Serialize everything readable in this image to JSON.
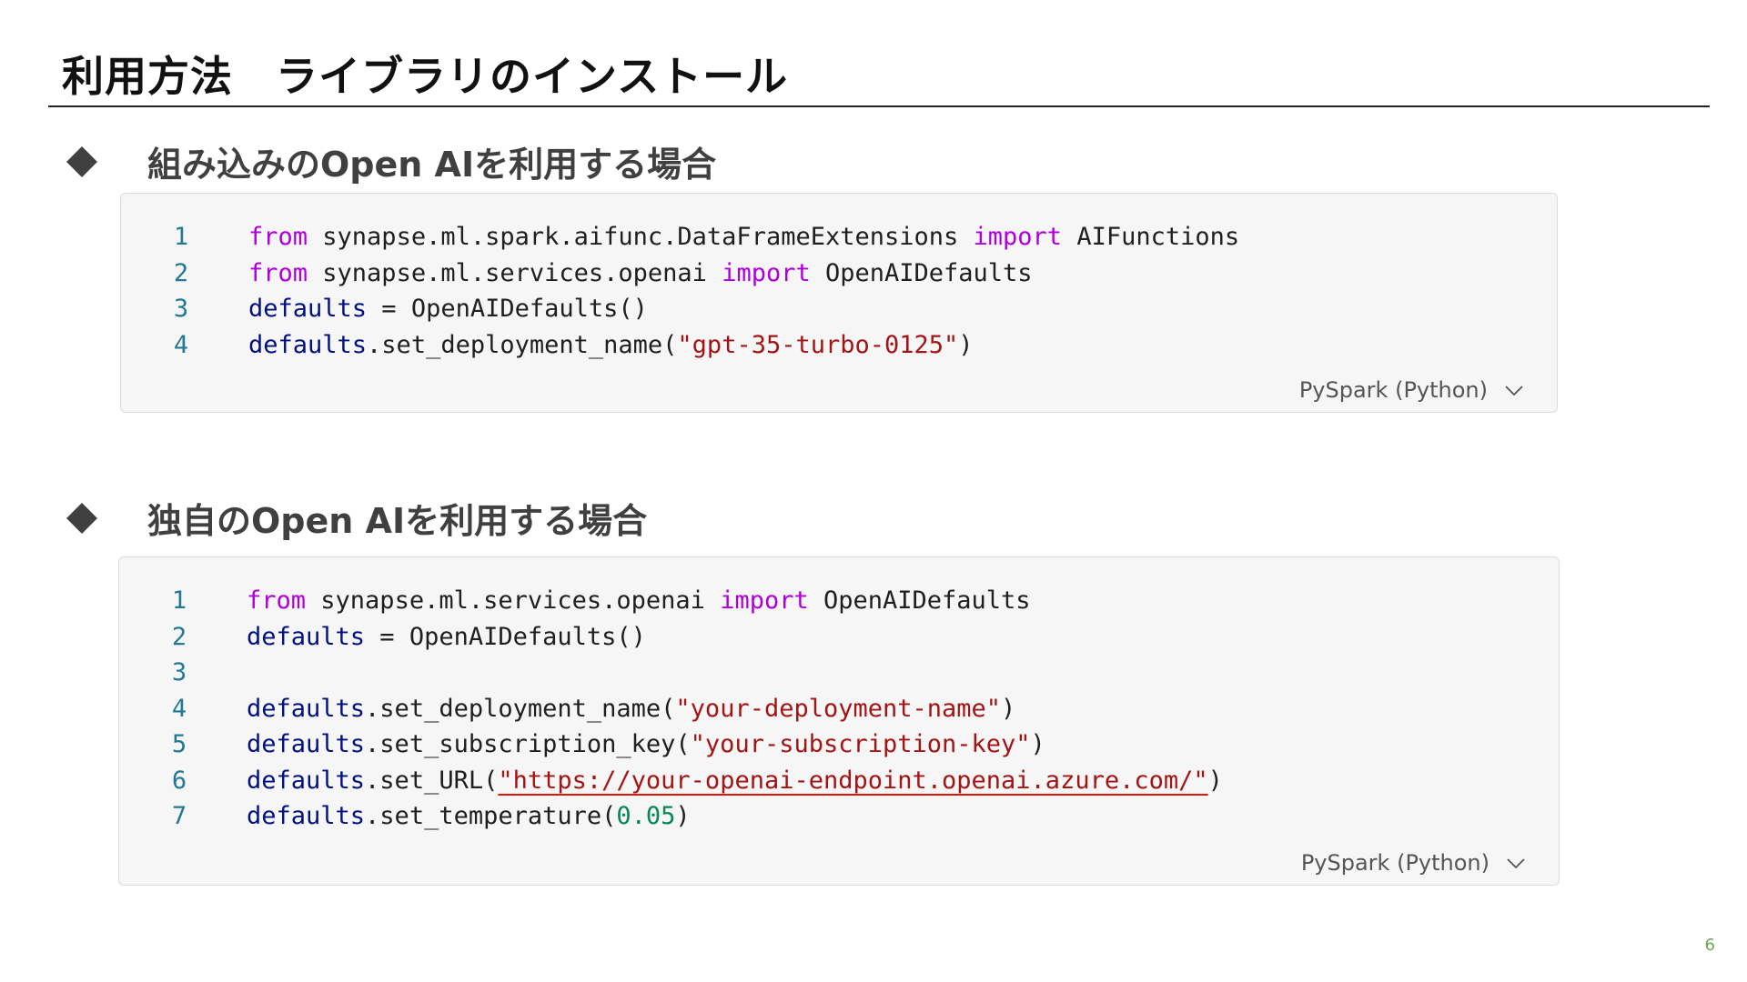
{
  "slide": {
    "title": "利用方法　ライブラリのインストール",
    "page_number": "6"
  },
  "sections": [
    {
      "heading": "組み込みのOpen AIを利用する場合",
      "language_label": "PySpark (Python)",
      "lines": [
        {
          "number": "1",
          "tokens": [
            {
              "t": "from",
              "c": "kw"
            },
            {
              "t": " synapse.ml.spark.aifunc.DataFrameExtensions ",
              "c": "plain"
            },
            {
              "t": "import",
              "c": "kw"
            },
            {
              "t": " AIFunctions",
              "c": "plain"
            }
          ]
        },
        {
          "number": "2",
          "tokens": [
            {
              "t": "from",
              "c": "kw"
            },
            {
              "t": " synapse.ml.services.openai ",
              "c": "plain"
            },
            {
              "t": "import",
              "c": "kw"
            },
            {
              "t": " OpenAIDefaults",
              "c": "plain"
            }
          ]
        },
        {
          "number": "3",
          "tokens": [
            {
              "t": "defaults",
              "c": "var"
            },
            {
              "t": " = OpenAIDefaults()",
              "c": "plain"
            }
          ]
        },
        {
          "number": "4",
          "tokens": [
            {
              "t": "defaults",
              "c": "var"
            },
            {
              "t": ".set_deployment_name(",
              "c": "plain"
            },
            {
              "t": "\"gpt-35-turbo-0125\"",
              "c": "str"
            },
            {
              "t": ")",
              "c": "plain"
            }
          ]
        }
      ]
    },
    {
      "heading": "独自のOpen AIを利用する場合",
      "language_label": "PySpark (Python)",
      "lines": [
        {
          "number": "1",
          "tokens": [
            {
              "t": "from",
              "c": "kw"
            },
            {
              "t": " synapse.ml.services.openai ",
              "c": "plain"
            },
            {
              "t": "import",
              "c": "kw"
            },
            {
              "t": " OpenAIDefaults",
              "c": "plain"
            }
          ]
        },
        {
          "number": "2",
          "tokens": [
            {
              "t": "defaults",
              "c": "var"
            },
            {
              "t": " = OpenAIDefaults()",
              "c": "plain"
            }
          ]
        },
        {
          "number": "3",
          "tokens": []
        },
        {
          "number": "4",
          "tokens": [
            {
              "t": "defaults",
              "c": "var"
            },
            {
              "t": ".set_deployment_name(",
              "c": "plain"
            },
            {
              "t": "\"your-deployment-name\"",
              "c": "str"
            },
            {
              "t": ")",
              "c": "plain"
            }
          ]
        },
        {
          "number": "5",
          "tokens": [
            {
              "t": "defaults",
              "c": "var"
            },
            {
              "t": ".set_subscription_key(",
              "c": "plain"
            },
            {
              "t": "\"your-subscription-key\"",
              "c": "str"
            },
            {
              "t": ")",
              "c": "plain"
            }
          ]
        },
        {
          "number": "6",
          "tokens": [
            {
              "t": "defaults",
              "c": "var"
            },
            {
              "t": ".set_URL(",
              "c": "plain"
            },
            {
              "t": "\"https://your-openai-endpoint.openai.azure.com/\"",
              "c": "str",
              "underline": true
            },
            {
              "t": ")",
              "c": "plain"
            }
          ]
        },
        {
          "number": "7",
          "tokens": [
            {
              "t": "defaults",
              "c": "var"
            },
            {
              "t": ".set_temperature(",
              "c": "plain"
            },
            {
              "t": "0.05",
              "c": "num"
            },
            {
              "t": ")",
              "c": "plain"
            }
          ]
        }
      ]
    }
  ],
  "colors": {
    "keyword": "#af00db",
    "variable": "#001080",
    "string": "#a31515",
    "number": "#098658",
    "line_number": "#237893",
    "page_number": "#6aa84f"
  },
  "icons": {
    "bullet": "diamond-bullet-icon",
    "language_dropdown": "chevron-down-icon"
  }
}
